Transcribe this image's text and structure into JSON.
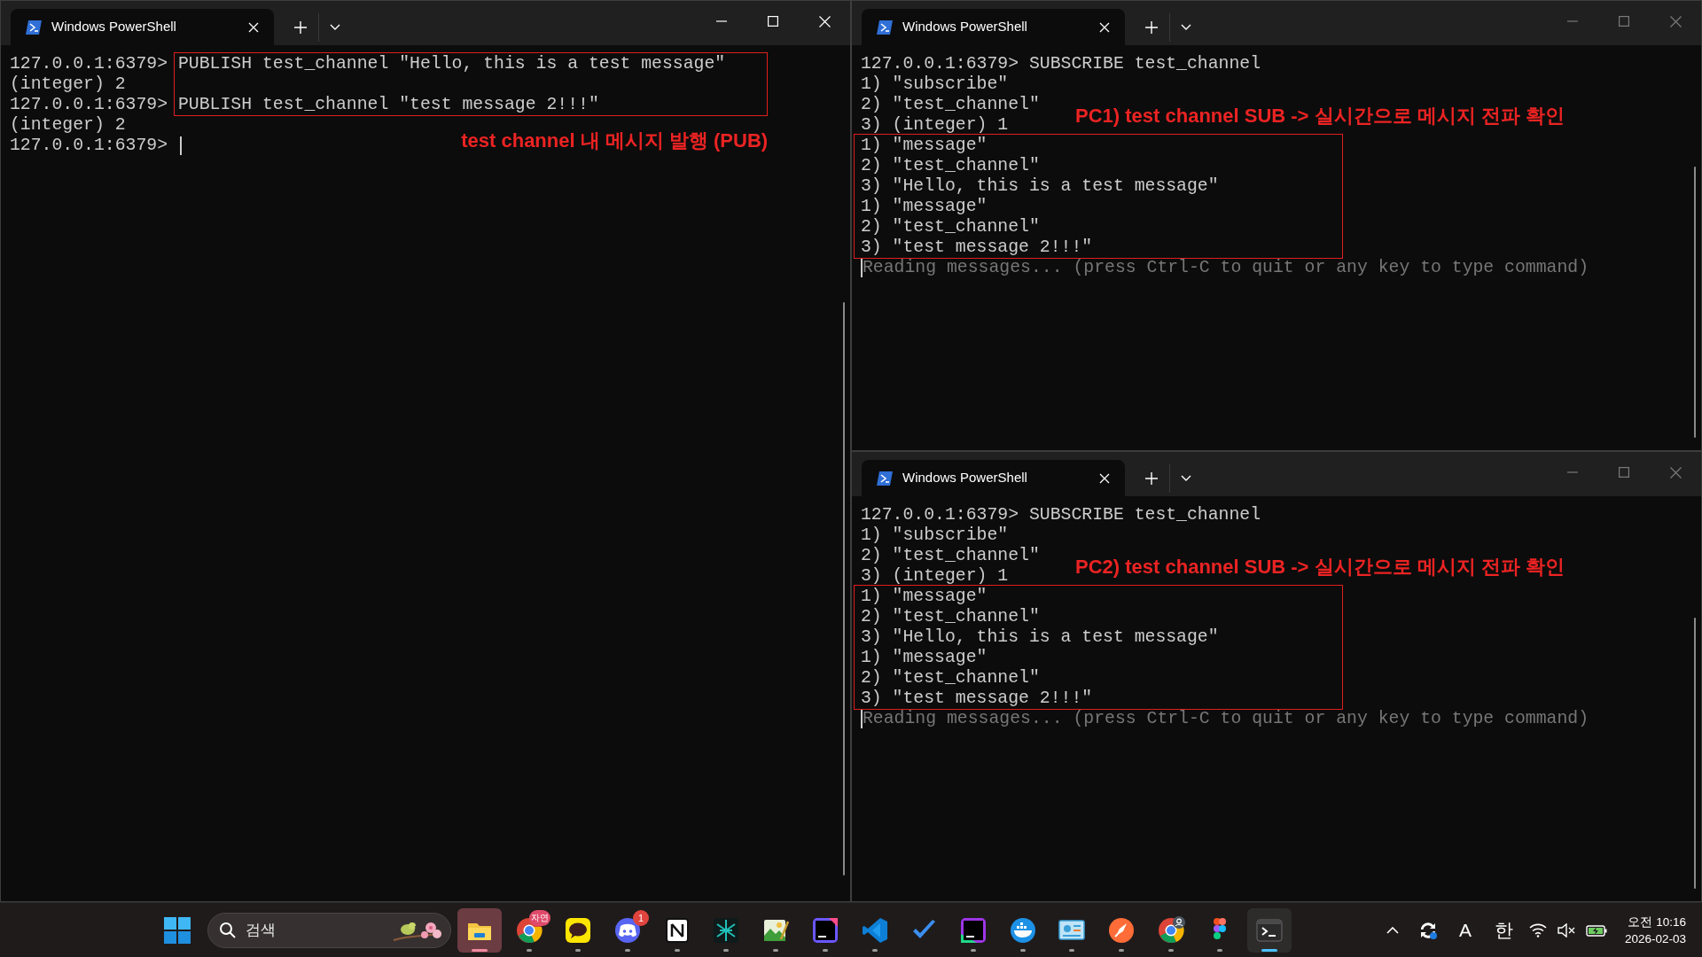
{
  "windows": [
    {
      "tab_title": "Windows PowerShell",
      "active": true,
      "blocks": [
        {
          "boxed": true,
          "lines": [
            {
              "prompt": "127.0.0.1:6379> ",
              "text": "PUBLISH test_channel \"Hello, this is a test message\""
            },
            {
              "text": "(integer) 2"
            },
            {
              "prompt": "127.0.0.1:6379> ",
              "text": "PUBLISH test_channel \"test message 2!!!\""
            }
          ]
        },
        {
          "boxed": false,
          "lines": [
            {
              "text": "(integer) 2"
            },
            {
              "prompt": "127.0.0.1:6379> ",
              "cursor": true
            }
          ]
        }
      ],
      "annotation": {
        "text": "test channel 내 메시지 발행 (PUB)",
        "below": true
      }
    },
    {
      "tab_title": "Windows PowerShell",
      "active": false,
      "blocks": [
        {
          "boxed": false,
          "lines": [
            {
              "prompt": "127.0.0.1:6379> ",
              "text": "SUBSCRIBE test_channel"
            },
            {
              "text": "1) \"subscribe\""
            },
            {
              "text": "2) \"test_channel\""
            },
            {
              "text": "3) (integer) 1"
            }
          ]
        },
        {
          "boxed": true,
          "lines": [
            {
              "text": "1) \"message\""
            },
            {
              "text": "2) \"test_channel\""
            },
            {
              "text": "3) \"Hello, this is a test message\""
            },
            {
              "text": "1) \"message\""
            },
            {
              "text": "2) \"test_channel\""
            },
            {
              "text": "3) \"test message 2!!!\""
            }
          ]
        },
        {
          "boxed": false,
          "lines": [
            {
              "text": "Reading messages... (press Ctrl-C to quit or any key to type command)",
              "dim": true,
              "cursor": true
            }
          ]
        }
      ],
      "annotation": {
        "text": "PC1) test channel SUB -> 실시간으로 메시지 전파 확인",
        "below": false
      }
    },
    {
      "tab_title": "Windows PowerShell",
      "active": false,
      "blocks": [
        {
          "boxed": false,
          "lines": [
            {
              "prompt": "127.0.0.1:6379> ",
              "text": "SUBSCRIBE test_channel"
            },
            {
              "text": "1) \"subscribe\""
            },
            {
              "text": "2) \"test_channel\""
            },
            {
              "text": "3) (integer) 1"
            }
          ]
        },
        {
          "boxed": true,
          "lines": [
            {
              "text": "1) \"message\""
            },
            {
              "text": "2) \"test_channel\""
            },
            {
              "text": "3) \"Hello, this is a test message\""
            },
            {
              "text": "1) \"message\""
            },
            {
              "text": "2) \"test_channel\""
            },
            {
              "text": "3) \"test message 2!!!\""
            }
          ]
        },
        {
          "boxed": false,
          "lines": [
            {
              "text": "Reading messages... (press Ctrl-C to quit or any key to type command)",
              "dim": true,
              "cursor": true
            }
          ]
        }
      ],
      "annotation": {
        "text": "PC2) test channel SUB -> 실시간으로 메시지 전파 확인",
        "below": false
      }
    }
  ],
  "taskbar": {
    "search": {
      "placeholder": "검색"
    },
    "apps": [
      {
        "kind": "folder",
        "running": true,
        "active": true
      },
      {
        "kind": "browser",
        "running": true,
        "active": false,
        "badge": "자연"
      },
      {
        "kind": "chat",
        "running": true,
        "active": false
      },
      {
        "kind": "gamepad",
        "running": true,
        "active": false,
        "badge": "1"
      },
      {
        "kind": "notes",
        "running": true,
        "active": false
      },
      {
        "kind": "sparkle",
        "running": true,
        "active": false
      },
      {
        "kind": "image",
        "running": true,
        "active": false
      },
      {
        "kind": "ide",
        "running": true,
        "active": false
      },
      {
        "kind": "editor",
        "running": true,
        "active": false
      },
      {
        "kind": "check",
        "running": false,
        "active": false
      },
      {
        "kind": "database",
        "running": true,
        "active": false
      },
      {
        "kind": "whale",
        "running": true,
        "active": false
      },
      {
        "kind": "board",
        "running": true,
        "active": false
      },
      {
        "kind": "rocket",
        "running": true,
        "active": false
      },
      {
        "kind": "browser-profile",
        "running": true,
        "active": false
      },
      {
        "kind": "design",
        "running": true,
        "active": false
      },
      {
        "kind": "terminal",
        "running": true,
        "active": true
      }
    ],
    "tray": {
      "input_mode": "A",
      "language": "한",
      "time": "오전 10:16",
      "date": "2026-02-03"
    }
  }
}
